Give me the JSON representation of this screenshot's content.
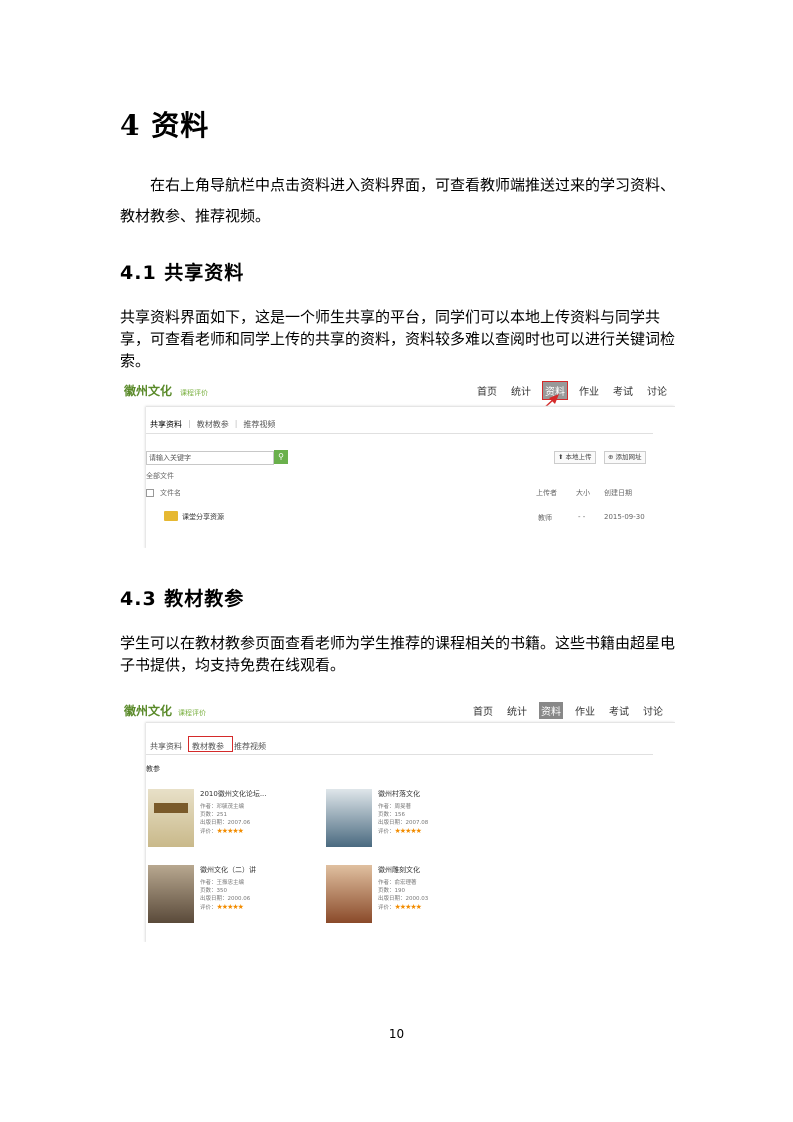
{
  "heading": "4  资料",
  "intro": "在右上角导航栏中点击资料进入资料界面，可查看教师端推送过来的学习资料、教材教参、推荐视频。",
  "section1": {
    "title": "4.1  共享资料",
    "text": "共享资料界面如下，这是一个师生共享的平台，同学们可以本地上传资料与同学共享，可查看老师和同学上传的共享的资料，资料较多难以查阅时也可以进行关键词检索。"
  },
  "section2": {
    "title": "4.3 教材教参",
    "text": "学生可以在教材教参页面查看老师为学生推荐的课程相关的书籍。这些书籍由超星电子书提供，均支持免费在线观看。"
  },
  "page_number": "10",
  "shot1": {
    "logo": "徽州文化",
    "logo_sub": "课程评价",
    "nav": [
      "首页",
      "统计",
      "资料",
      "作业",
      "考试",
      "讨论"
    ],
    "tabs": [
      "共享资料",
      "|",
      "教材教参",
      "|",
      "推荐视频"
    ],
    "search_placeholder": "请输入关键字",
    "search_icon": "search-icon",
    "upload_btn": "本地上传",
    "newfolder_btn": "添加网址",
    "all_files": "全部文件",
    "cols": [
      "文件名",
      "上传者",
      "大小",
      "创建日期"
    ],
    "row": {
      "name": "课堂分享资源",
      "owner": "教师",
      "size": "- -",
      "date": "2015-09-30"
    }
  },
  "shot2": {
    "logo": "徽州文化",
    "logo_sub": "课程评价",
    "nav": [
      "首页",
      "统计",
      "资料",
      "作业",
      "考试",
      "讨论"
    ],
    "tabs": [
      "共享资料",
      "教材教参",
      "推荐视频"
    ],
    "section_label": "教参",
    "books": [
      {
        "title": "2010徽州文化论坛...",
        "author": "作者：邓毓茂主编",
        "pages": "页数：251",
        "date": "出版日期：2007.06",
        "rating": "评价：",
        "stars": "★★★★★"
      },
      {
        "title": "徽州村落文化",
        "author": "作者：周旻著",
        "pages": "页数：156",
        "date": "出版日期：2007.08",
        "rating": "评价：",
        "stars": "★★★★★"
      },
      {
        "title": "徽州文化（二）讲",
        "author": "作者：王振忠主编",
        "pages": "页数：350",
        "date": "出版日期：2000.06",
        "rating": "评价：",
        "stars": "★★★★★"
      },
      {
        "title": "徽州雕刻文化",
        "author": "作者：俞宏理著",
        "pages": "页数：190",
        "date": "出版日期：2000.03",
        "rating": "评价：",
        "stars": "★★★★★"
      }
    ]
  }
}
